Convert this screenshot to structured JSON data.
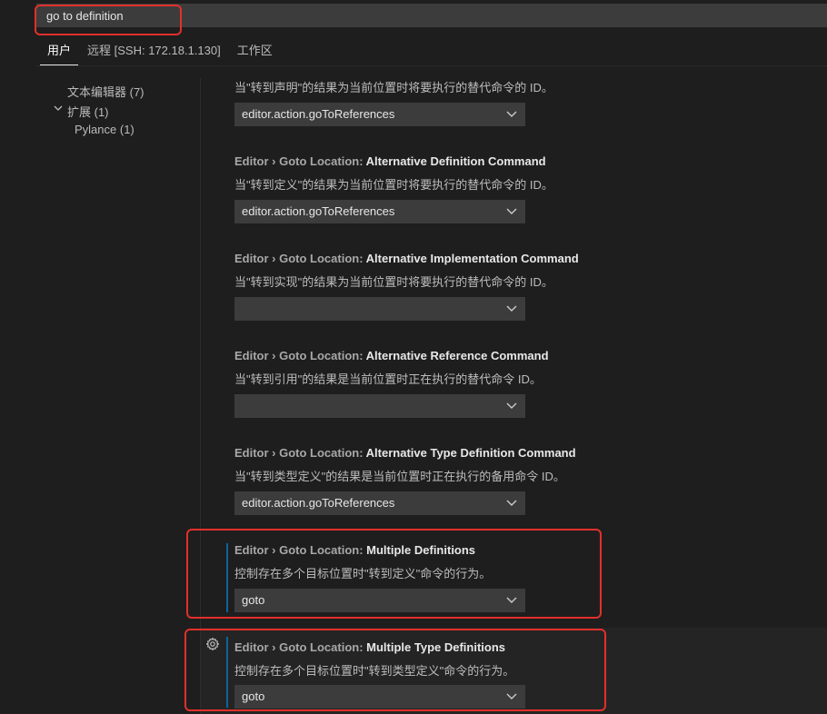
{
  "search": {
    "value": "go to definition",
    "placeholder": ""
  },
  "tabs": [
    {
      "label": "用户"
    },
    {
      "label": "远程 [SSH: 172.18.1.130]"
    },
    {
      "label": "工作区"
    }
  ],
  "toc": {
    "text_editor": "文本编辑器 (7)",
    "extensions": "扩展 (1)",
    "pylance": "Pylance (1)"
  },
  "settings": [
    {
      "category": "",
      "name": "",
      "description": "当\"转到声明\"的结果为当前位置时将要执行的替代命令的 ID。",
      "value": "editor.action.goToReferences"
    },
    {
      "category": "Editor › Goto Location: ",
      "name": "Alternative Definition Command",
      "description": "当\"转到定义\"的结果为当前位置时将要执行的替代命令的 ID。",
      "value": "editor.action.goToReferences"
    },
    {
      "category": "Editor › Goto Location: ",
      "name": "Alternative Implementation Command",
      "description": "当\"转到实现\"的结果为当前位置时将要执行的替代命令的 ID。",
      "value": ""
    },
    {
      "category": "Editor › Goto Location: ",
      "name": "Alternative Reference Command",
      "description": "当\"转到引用\"的结果是当前位置时正在执行的替代命令 ID。",
      "value": ""
    },
    {
      "category": "Editor › Goto Location: ",
      "name": "Alternative Type Definition Command",
      "description": "当\"转到类型定义\"的结果是当前位置时正在执行的备用命令 ID。",
      "value": "editor.action.goToReferences"
    },
    {
      "category": "Editor › Goto Location: ",
      "name": "Multiple Definitions",
      "description": "控制存在多个目标位置时\"转到定义\"命令的行为。",
      "value": "goto"
    },
    {
      "category": "Editor › Goto Location: ",
      "name": "Multiple Type Definitions",
      "description": "控制存在多个目标位置时\"转到类型定义\"命令的行为。",
      "value": "goto"
    }
  ],
  "colors": {
    "highlight": "#e2302b",
    "modified_bar": "#0e639c",
    "background": "#1e1e1e"
  },
  "icons": {
    "gear": "gear-icon",
    "chevron": "chevron-down-icon"
  }
}
